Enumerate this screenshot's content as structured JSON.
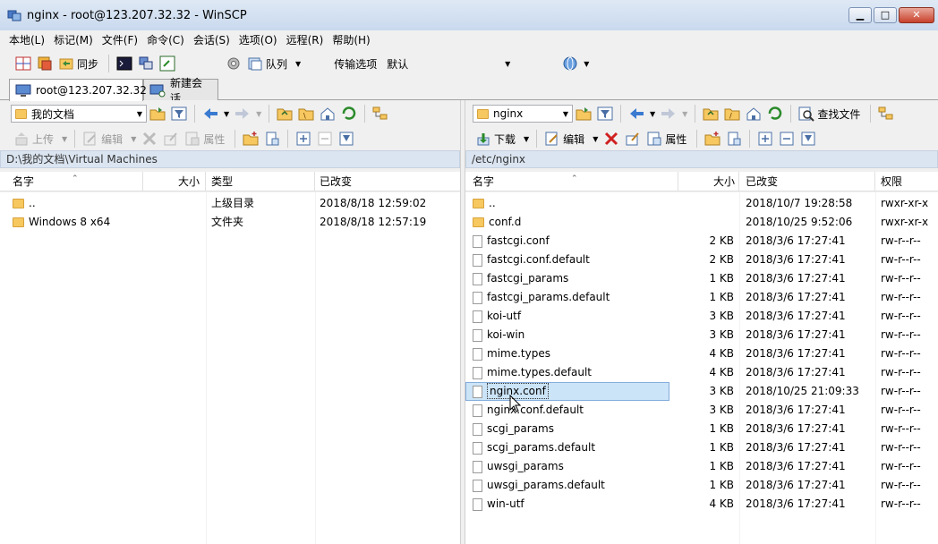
{
  "window": {
    "title": "nginx - root@123.207.32.32 - WinSCP",
    "min": "▁",
    "max": "□",
    "close": "✕"
  },
  "menu": [
    "本地(L)",
    "标记(M)",
    "文件(F)",
    "命令(C)",
    "会话(S)",
    "选项(O)",
    "远程(R)",
    "帮助(H)"
  ],
  "toolbar": {
    "sync_label": "同步",
    "queue_label": "队列",
    "transfer_label": "传输选项",
    "transfer_value": "默认"
  },
  "tabs": [
    {
      "label": "root@123.207.32.32"
    },
    {
      "label": "新建会话"
    }
  ],
  "left": {
    "location": "我的文档",
    "actions": {
      "upload": "上传",
      "edit": "编辑",
      "props": "属性"
    },
    "path": "D:\\我的文档\\Virtual Machines",
    "columns": {
      "name": "名字",
      "size": "大小",
      "type": "类型",
      "changed": "已改变"
    },
    "files": [
      {
        "name": "..",
        "size": "",
        "type": "上级目录",
        "changed": "2018/8/18   12:59:02"
      },
      {
        "name": "Windows 8 x64",
        "size": "",
        "type": "文件夹",
        "changed": "2018/8/18   12:57:19"
      }
    ]
  },
  "right": {
    "location": "nginx",
    "actions": {
      "find": "查找文件",
      "download": "下载",
      "edit": "编辑",
      "props": "属性"
    },
    "path": "/etc/nginx",
    "columns": {
      "name": "名字",
      "size": "大小",
      "changed": "已改变",
      "rights": "权限"
    },
    "files": [
      {
        "name": "..",
        "size": "",
        "changed": "2018/10/7 19:28:58",
        "rights": "rwxr-xr-x",
        "kind": "up"
      },
      {
        "name": "conf.d",
        "size": "",
        "changed": "2018/10/25 9:52:06",
        "rights": "rwxr-xr-x",
        "kind": "folder"
      },
      {
        "name": "fastcgi.conf",
        "size": "2 KB",
        "changed": "2018/3/6 17:27:41",
        "rights": "rw-r--r--",
        "kind": "file"
      },
      {
        "name": "fastcgi.conf.default",
        "size": "2 KB",
        "changed": "2018/3/6 17:27:41",
        "rights": "rw-r--r--",
        "kind": "file"
      },
      {
        "name": "fastcgi_params",
        "size": "1 KB",
        "changed": "2018/3/6 17:27:41",
        "rights": "rw-r--r--",
        "kind": "file"
      },
      {
        "name": "fastcgi_params.default",
        "size": "1 KB",
        "changed": "2018/3/6 17:27:41",
        "rights": "rw-r--r--",
        "kind": "file"
      },
      {
        "name": "koi-utf",
        "size": "3 KB",
        "changed": "2018/3/6 17:27:41",
        "rights": "rw-r--r--",
        "kind": "file"
      },
      {
        "name": "koi-win",
        "size": "3 KB",
        "changed": "2018/3/6 17:27:41",
        "rights": "rw-r--r--",
        "kind": "file"
      },
      {
        "name": "mime.types",
        "size": "4 KB",
        "changed": "2018/3/6 17:27:41",
        "rights": "rw-r--r--",
        "kind": "file"
      },
      {
        "name": "mime.types.default",
        "size": "4 KB",
        "changed": "2018/3/6 17:27:41",
        "rights": "rw-r--r--",
        "kind": "file"
      },
      {
        "name": "nginx.conf",
        "size": "3 KB",
        "changed": "2018/10/25 21:09:33",
        "rights": "rw-r--r--",
        "kind": "file",
        "selected": true
      },
      {
        "name": "nginx.conf.default",
        "size": "3 KB",
        "changed": "2018/3/6 17:27:41",
        "rights": "rw-r--r--",
        "kind": "file"
      },
      {
        "name": "scgi_params",
        "size": "1 KB",
        "changed": "2018/3/6 17:27:41",
        "rights": "rw-r--r--",
        "kind": "file"
      },
      {
        "name": "scgi_params.default",
        "size": "1 KB",
        "changed": "2018/3/6 17:27:41",
        "rights": "rw-r--r--",
        "kind": "file"
      },
      {
        "name": "uwsgi_params",
        "size": "1 KB",
        "changed": "2018/3/6 17:27:41",
        "rights": "rw-r--r--",
        "kind": "file"
      },
      {
        "name": "uwsgi_params.default",
        "size": "1 KB",
        "changed": "2018/3/6 17:27:41",
        "rights": "rw-r--r--",
        "kind": "file"
      },
      {
        "name": "win-utf",
        "size": "4 KB",
        "changed": "2018/3/6 17:27:41",
        "rights": "rw-r--r--",
        "kind": "file"
      }
    ]
  }
}
